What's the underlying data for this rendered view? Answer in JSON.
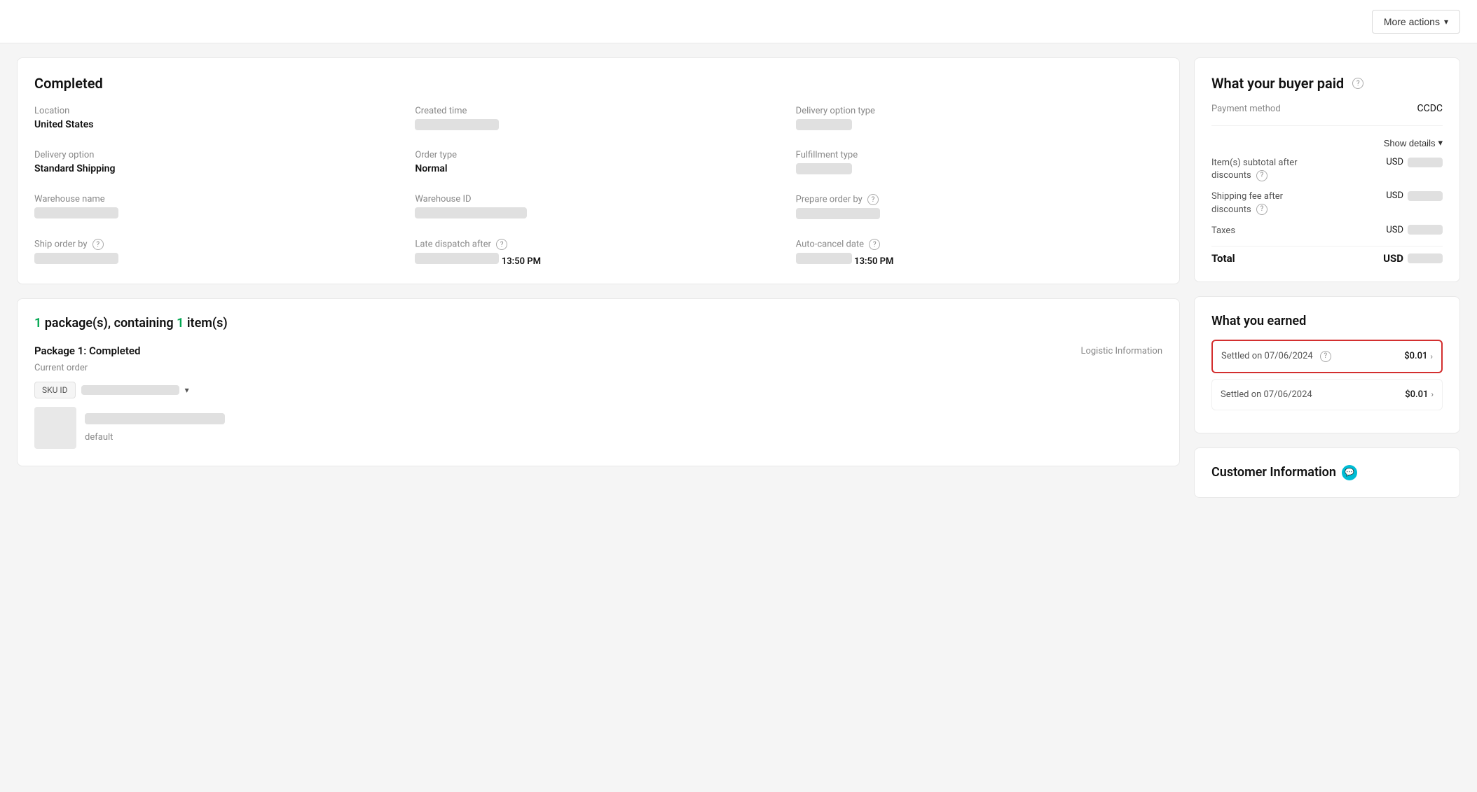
{
  "topbar": {
    "more_actions_label": "More actions"
  },
  "order_card": {
    "title": "Completed",
    "fields": {
      "location_label": "Location",
      "location_value": "United States",
      "created_time_label": "Created time",
      "delivery_option_type_label": "Delivery option type",
      "delivery_option_label": "Delivery option",
      "delivery_option_value": "Standard Shipping",
      "order_type_label": "Order type",
      "order_type_value": "Normal",
      "fulfillment_type_label": "Fulfillment type",
      "warehouse_name_label": "Warehouse name",
      "warehouse_id_label": "Warehouse ID",
      "prepare_order_label": "Prepare order by",
      "ship_order_label": "Ship order by",
      "late_dispatch_label": "Late dispatch after",
      "late_dispatch_partial": "13:50 PM",
      "auto_cancel_label": "Auto-cancel date",
      "auto_cancel_partial": "13:50 PM"
    }
  },
  "payment_card": {
    "title": "What your buyer paid",
    "payment_method_label": "Payment method",
    "payment_method_value": "CCDC",
    "show_details_label": "Show details",
    "items_subtotal_label": "Item(s) subtotal after discounts",
    "items_subtotal_currency": "USD",
    "shipping_fee_label": "Shipping fee after discounts",
    "shipping_fee_currency": "USD",
    "taxes_label": "Taxes",
    "taxes_currency": "USD",
    "total_label": "Total",
    "total_currency": "USD"
  },
  "package_section": {
    "header_prefix": "1",
    "header_middle": " package(s), containing ",
    "header_count": "1",
    "header_suffix": " item(s)",
    "package_title": "Package 1: Completed",
    "logistic_label": "Logistic Information",
    "current_order_label": "Current order",
    "sku_label": "SKU ID"
  },
  "earned_card": {
    "title": "What you earned",
    "settled_1_date": "Settled on 07/06/2024",
    "settled_1_amount": "$0.01",
    "settled_2_date": "Settled on 07/06/2024",
    "settled_2_amount": "$0.01"
  },
  "customer_card": {
    "title": "Customer Information"
  }
}
